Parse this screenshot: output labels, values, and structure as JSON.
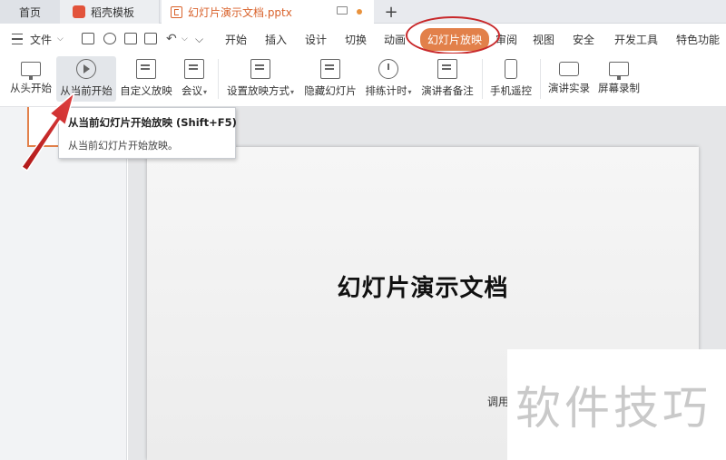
{
  "tabs": {
    "home": "首页",
    "template": "稻壳模板",
    "document": "幻灯片演示文档.pptx",
    "add": "+"
  },
  "menu": {
    "file": "文件",
    "items": [
      "开始",
      "插入",
      "设计",
      "切换",
      "动画",
      "幻灯片放映",
      "审阅",
      "视图",
      "安全",
      "开发工具",
      "特色功能"
    ],
    "active": "幻灯片放映"
  },
  "ribbon": {
    "from_start": "从头开始",
    "from_current": "从当前开始",
    "custom_show": "自定义放映",
    "meeting": "会议",
    "setup_show": "设置放映方式",
    "hide_slide": "隐藏幻灯片",
    "rehearse": "排练计时",
    "speaker_notes": "演讲者备注",
    "phone_remote": "手机遥控",
    "record_show": "演讲实录",
    "screen_record": "屏幕录制"
  },
  "tooltip": {
    "title": "从当前幻灯片开始放映 (Shift+F5)",
    "desc": "从当前幻灯片开始放映。"
  },
  "slide": {
    "title": "幻灯片演示文档",
    "subtitle_partial": "调用"
  },
  "watermark": "软件技巧",
  "colors": {
    "accent": "#e2804a",
    "highlight_ring": "#c8282a",
    "doc_tab_text": "#d9622b"
  }
}
